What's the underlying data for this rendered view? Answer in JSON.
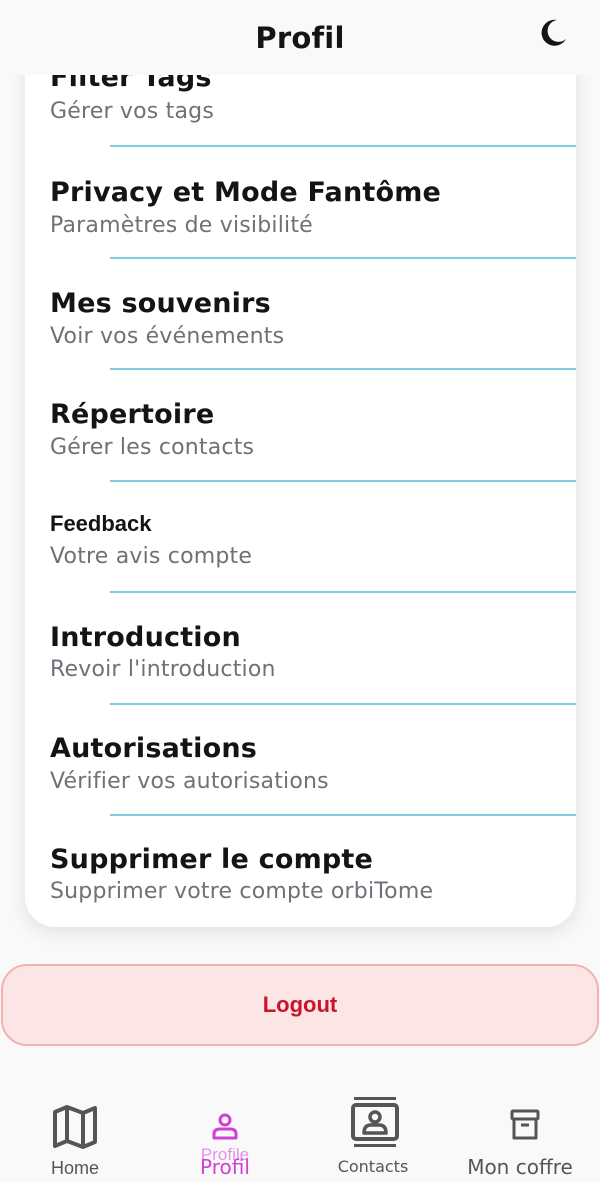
{
  "header": {
    "title": "Profil",
    "theme_icon": "moon-icon"
  },
  "settings": [
    {
      "title": "Filter Tags",
      "subtitle": "Gérer vos tags"
    },
    {
      "title": "Privacy et Mode Fantôme",
      "subtitle": "Paramètres de visibilité"
    },
    {
      "title": "Mes souvenirs",
      "subtitle": "Voir vos événements"
    },
    {
      "title": "Répertoire",
      "subtitle": "Gérer les contacts"
    },
    {
      "title": "Feedback",
      "subtitle": "Votre avis compte"
    },
    {
      "title": "Introduction",
      "subtitle": "Revoir l'introduction"
    },
    {
      "title": "Autorisations",
      "subtitle": "Vérifier vos autorisations"
    },
    {
      "title": "Supprimer le compte",
      "subtitle": "Supprimer votre compte orbiTome"
    }
  ],
  "logout": {
    "label": "Logout"
  },
  "tabbar": {
    "items": [
      {
        "label": "Home",
        "icon": "map-icon"
      },
      {
        "label": "Profil",
        "ghost_label": "Profile",
        "icon": "person-icon",
        "active": true
      },
      {
        "label": "Contacts",
        "icon": "contacts-icon"
      },
      {
        "label": "Mon coffre",
        "icon": "archive-icon"
      }
    ]
  },
  "colors": {
    "accent": "#d23fd6",
    "divider": "#7fcbe0",
    "logout_text": "#c9142b",
    "logout_bg": "#fce5e5",
    "logout_border": "#f2b2ae",
    "subtitle": "#707078",
    "nav_icon": "#555555"
  }
}
